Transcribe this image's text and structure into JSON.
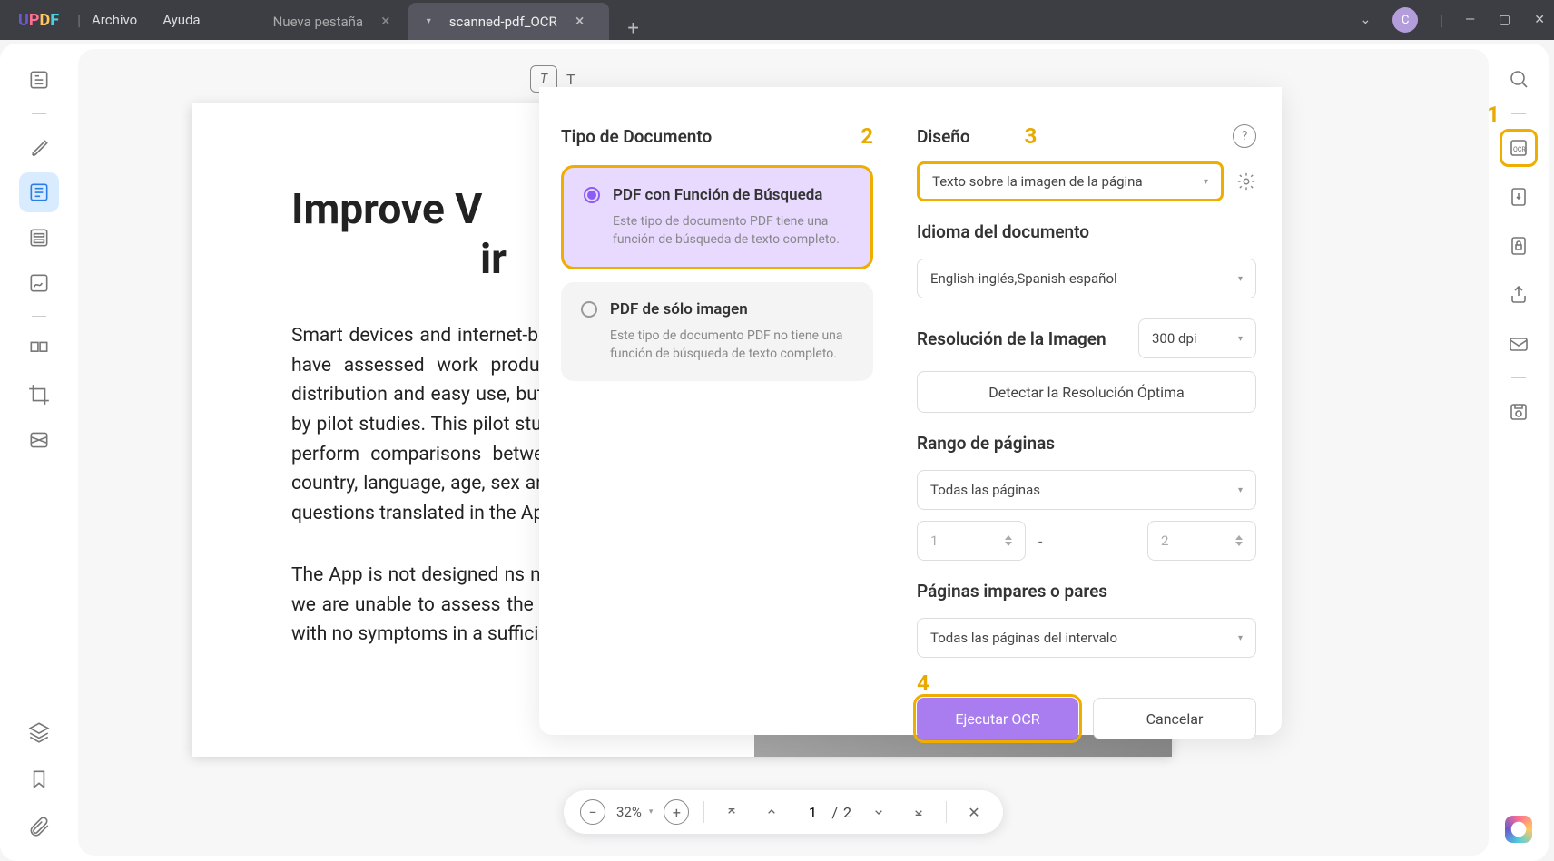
{
  "titlebar": {
    "logo_chars": [
      "U",
      "P",
      "D",
      "F"
    ],
    "menu": [
      "Archivo",
      "Ayuda"
    ],
    "tabs": [
      {
        "label": "Nueva pestaña",
        "active": false
      },
      {
        "label": "scanned-pdf_OCR",
        "active": true
      }
    ],
    "avatar_letter": "C"
  },
  "document": {
    "title_line1": "Improve V",
    "title_line2": "ir",
    "para1": "Smart devices and internet-based applications (apps) are already used in rhinitis (24-28), but none have assessed work productivity. The strengths of our mobile technology include its wide distribution and easy use, but there is a need for appropriate questions and results to be assessed by pilot studies. This pilot study is based on 1,136 users who filled in over 5,000 VAS allowing us to perform comparisons between outcomes, but not to make subgroup analyses. We collected country, language, age, sex and date of entry of information with good results. We used very simple questions translated in the App translated into 15 languages.",
    "para2": "The App is not designed                                                 ns not a clinical trial. Thus, as expected, over 98% users reported \"AR\" and we are unable to assess the responses of \"non AR\" users. On the other hand, there are many days with no symptoms in a sufficient number of persons"
  },
  "toolbar_char": "T₁",
  "ocr": {
    "doc_type_label": "Tipo de Documento",
    "option1_title": "PDF con Función de Búsqueda",
    "option1_desc": "Este tipo de documento PDF tiene una función de búsqueda de texto completo.",
    "option2_title": "PDF de sólo imagen",
    "option2_desc": "Este tipo de documento PDF no tiene una función de búsqueda de texto completo.",
    "design_label": "Diseño",
    "design_value": "Texto sobre la imagen de la página",
    "language_label": "Idioma del documento",
    "language_value": "English-inglés,Spanish-español",
    "resolution_label": "Resolución de la Imagen",
    "resolution_value": "300 dpi",
    "detect_btn": "Detectar la Resolución Óptima",
    "range_label": "Rango de páginas",
    "range_value": "Todas las páginas",
    "range_from": "1",
    "range_sep": "-",
    "range_to": "2",
    "oddeven_label": "Páginas impares o pares",
    "oddeven_value": "Todas las páginas del intervalo",
    "run_btn": "Ejecutar OCR",
    "cancel_btn": "Cancelar"
  },
  "annotations": {
    "a1": "1",
    "a2": "2",
    "a3": "3",
    "a4": "4"
  },
  "bottombar": {
    "zoom": "32%",
    "page_current": "1",
    "page_sep": "/",
    "page_total": "2"
  }
}
